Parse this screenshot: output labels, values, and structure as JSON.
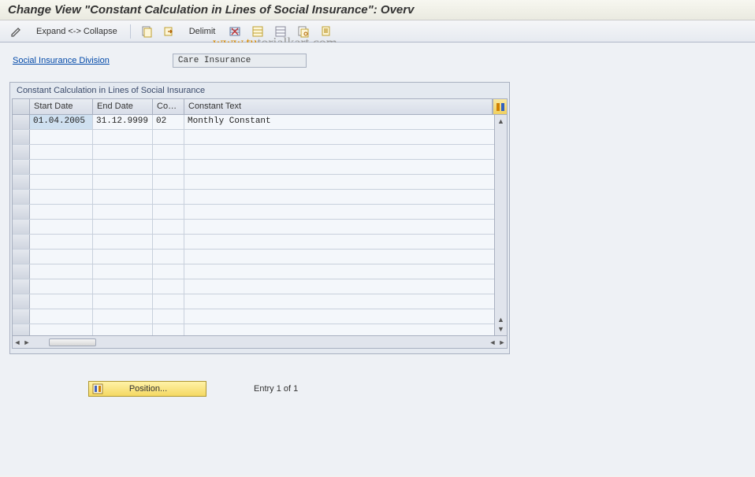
{
  "title": "Change View \"Constant Calculation in Lines of Social Insurance\": Overv",
  "toolbar": {
    "expand_collapse": "Expand <-> Collapse",
    "delimit": "Delimit"
  },
  "form": {
    "division_label": "Social Insurance Division",
    "division_value": "Care Insurance"
  },
  "panel": {
    "title": "Constant Calculation in Lines of Social Insurance",
    "columns": {
      "start": "Start Date",
      "end": "End Date",
      "con": "Con...",
      "text": "Constant Text"
    },
    "rows": [
      {
        "start": "01.04.2005",
        "end": "31.12.9999",
        "con": "02",
        "text": "Monthly Constant"
      }
    ]
  },
  "footer": {
    "position_btn": "Position...",
    "entry_text": "Entry 1 of 1"
  },
  "watermark": {
    "part1": "www.tu",
    "part2": "torialkart.com"
  },
  "colors": {
    "accent_yellow": "#f4d862",
    "link_blue": "#0048a8"
  }
}
